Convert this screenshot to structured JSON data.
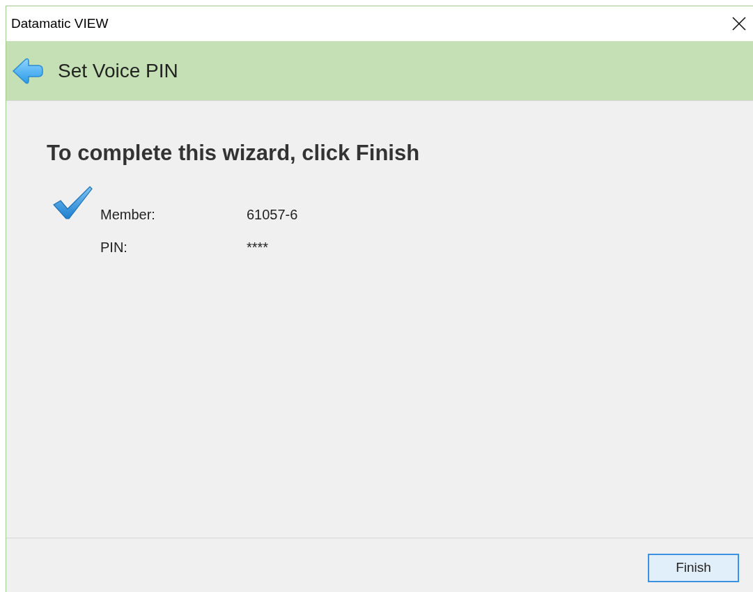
{
  "window": {
    "title": "Datamatic VIEW"
  },
  "header": {
    "title": "Set Voice PIN"
  },
  "heading": "To complete this wizard, click Finish",
  "summary": [
    {
      "label": "Member:",
      "value": "61057-6"
    },
    {
      "label": "PIN:",
      "value": "****"
    }
  ],
  "buttons": [
    {
      "label": "Finish",
      "focused": true
    }
  ]
}
